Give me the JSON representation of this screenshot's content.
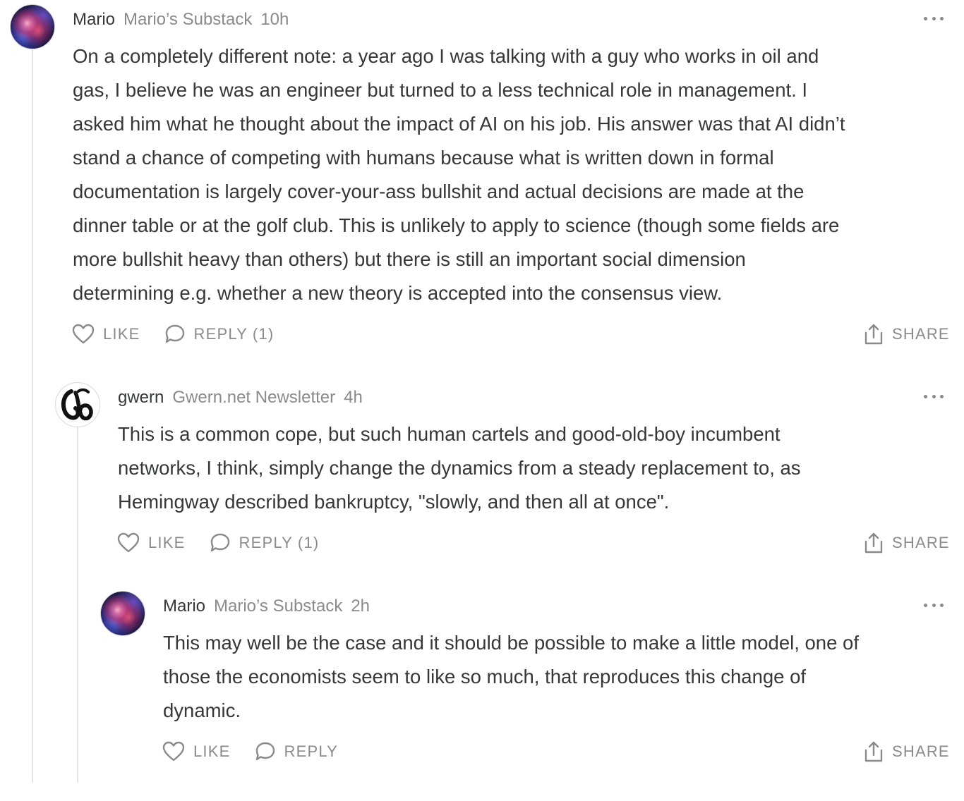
{
  "comments": [
    {
      "author": "Mario",
      "publication": "Mario’s Substack",
      "time": "10h",
      "avatar": "nebula-avatar",
      "lines": [
        "On a completely different note: a year ago I was talking with a guy who works in oil and",
        "gas, I believe he was an engineer but turned to a less technical role in management. I",
        "asked him what he thought about the impact of AI on his job. His answer was that AI didn’t",
        "stand a chance of competing with humans because what is written down in formal",
        "documentation is largely cover-your-ass bullshit and actual decisions are made at the",
        "dinner table or at the golf club. This is unlikely to apply to science (though some fields are",
        "more bullshit heavy than others) but there is still an important social dimension",
        "determining e.g. whether a new theory is accepted into the consensus view."
      ],
      "like_label": "LIKE",
      "reply_label": "REPLY (1)",
      "share_label": "SHARE"
    },
    {
      "author": "gwern",
      "publication": "Gwern.net Newsletter",
      "time": "4h",
      "avatar": "gwern-logo-avatar",
      "lines": [
        "This is a common cope, but such human cartels and good-old-boy incumbent",
        "networks, I think, simply change the dynamics from a steady replacement to, as",
        "Hemingway described bankruptcy, \"slowly, and then all at once\"."
      ],
      "like_label": "LIKE",
      "reply_label": "REPLY (1)",
      "share_label": "SHARE"
    },
    {
      "author": "Mario",
      "publication": "Mario’s Substack",
      "time": "2h",
      "avatar": "nebula-avatar",
      "lines": [
        "This may well be the case and it should be possible to make a little model, one of",
        "those the economists seem to like so much, that reproduces this change of",
        "dynamic."
      ],
      "like_label": "LIKE",
      "reply_label": "REPLY",
      "share_label": "SHARE"
    }
  ],
  "colors": {
    "text": "#363737",
    "muted": "#8a8a8a",
    "thread_line": "#e6e6e6"
  }
}
